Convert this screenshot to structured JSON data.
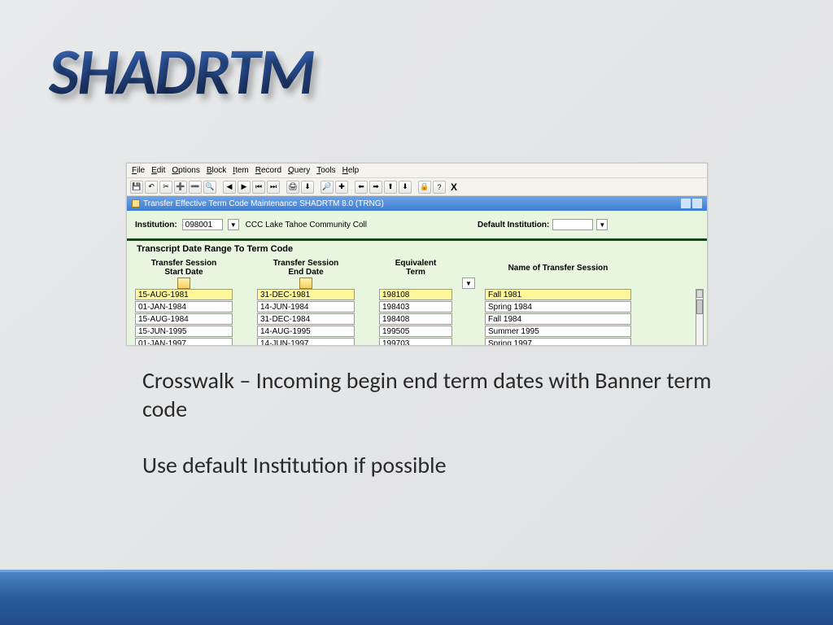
{
  "slide": {
    "title": "SHADRTM",
    "body_p1": "Crosswalk – Incoming begin end term dates with Banner term code",
    "body_p2": "Use default Institution if possible"
  },
  "form": {
    "menu": [
      "File",
      "Edit",
      "Options",
      "Block",
      "Item",
      "Record",
      "Query",
      "Tools",
      "Help"
    ],
    "toolbar_close": "X",
    "title": "Transfer Effective Term Code Maintenance  SHADRTM  8.0  (TRNG)",
    "institution_label": "Institution:",
    "institution_code": "098001",
    "institution_name": "CCC Lake Tahoe Community Coll",
    "default_institution_label": "Default Institution:",
    "default_institution_value": "",
    "section_title": "Transcript Date Range To Term Code",
    "columns": {
      "c1a": "Transfer Session",
      "c1b": "Start Date",
      "c2a": "Transfer Session",
      "c2b": "End Date",
      "c3a": "Equivalent",
      "c3b": "Term",
      "c4": "Name of Transfer Session"
    },
    "rows": [
      {
        "start": "15-AUG-1981",
        "end": "31-DEC-1981",
        "term": "198108",
        "name": "Fall 1981",
        "selected": true
      },
      {
        "start": "01-JAN-1984",
        "end": "14-JUN-1984",
        "term": "198403",
        "name": "Spring 1984"
      },
      {
        "start": "15-AUG-1984",
        "end": "31-DEC-1984",
        "term": "198408",
        "name": "Fall 1984"
      },
      {
        "start": "15-JUN-1995",
        "end": "14-AUG-1995",
        "term": "199505",
        "name": "Summer 1995"
      },
      {
        "start": "01-JAN-1997",
        "end": "14-JUN-1997",
        "term": "199703",
        "name": "Spring 1997"
      }
    ]
  }
}
